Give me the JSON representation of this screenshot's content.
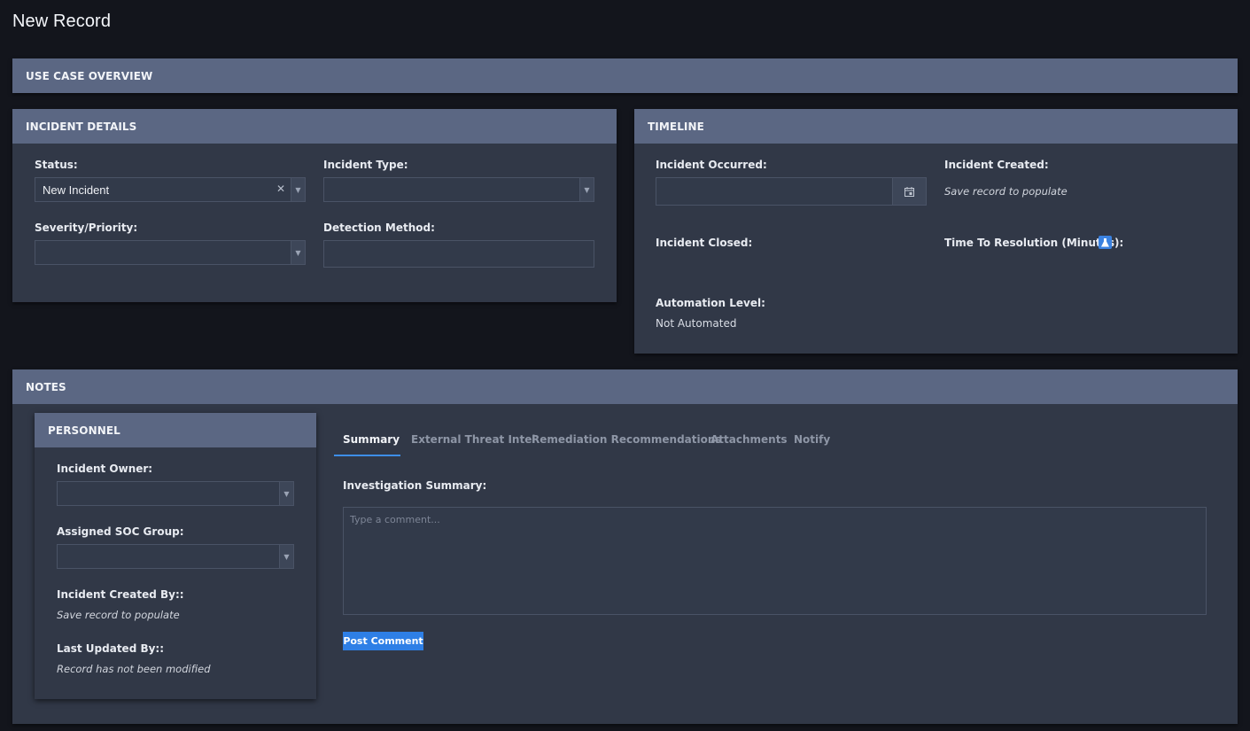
{
  "page": {
    "title": "New Record"
  },
  "overview": {
    "header": "USE CASE OVERVIEW"
  },
  "incident_details": {
    "header": "INCIDENT DETAILS",
    "status_label": "Status:",
    "status_value": "New Incident",
    "incident_type_label": "Incident Type:",
    "incident_type_value": "",
    "severity_label": "Severity/Priority:",
    "severity_value": "",
    "detection_label": "Detection Method:",
    "detection_value": ""
  },
  "timeline": {
    "header": "TIMELINE",
    "occurred_label": "Incident Occurred:",
    "occurred_value": "",
    "created_label": "Incident Created:",
    "created_value": "Save record to populate",
    "closed_label": "Incident Closed:",
    "resolution_label": "Time To Resolution (Minutes):",
    "automation_label": "Automation Level:",
    "automation_value": "Not Automated"
  },
  "notes": {
    "header": "NOTES",
    "personnel": {
      "header": "PERSONNEL",
      "owner_label": "Incident Owner:",
      "owner_value": "",
      "soc_group_label": "Assigned SOC Group:",
      "soc_group_value": "",
      "created_by_label": "Incident Created By::",
      "created_by_value": "Save record to populate",
      "updated_by_label": "Last Updated By::",
      "updated_by_value": "Record has not been modified"
    },
    "tabs": [
      {
        "label": "Summary",
        "active": true
      },
      {
        "label": "External Threat Intel",
        "active": false
      },
      {
        "label": "Remediation Recommendations",
        "active": false
      },
      {
        "label": "Attachments",
        "active": false
      },
      {
        "label": "Notify",
        "active": false
      }
    ],
    "summary_label": "Investigation Summary:",
    "comment_placeholder": "Type a comment...",
    "post_button": "Post Comment"
  },
  "icons": {
    "clear": "x-clear-icon",
    "dropdown": "chevron-down-icon",
    "calendar": "calendar-icon",
    "calculated": "flask-icon"
  },
  "colors": {
    "background": "#13151c",
    "panel": "#313847",
    "header": "#5b6783",
    "accent": "#2e7fe6"
  }
}
